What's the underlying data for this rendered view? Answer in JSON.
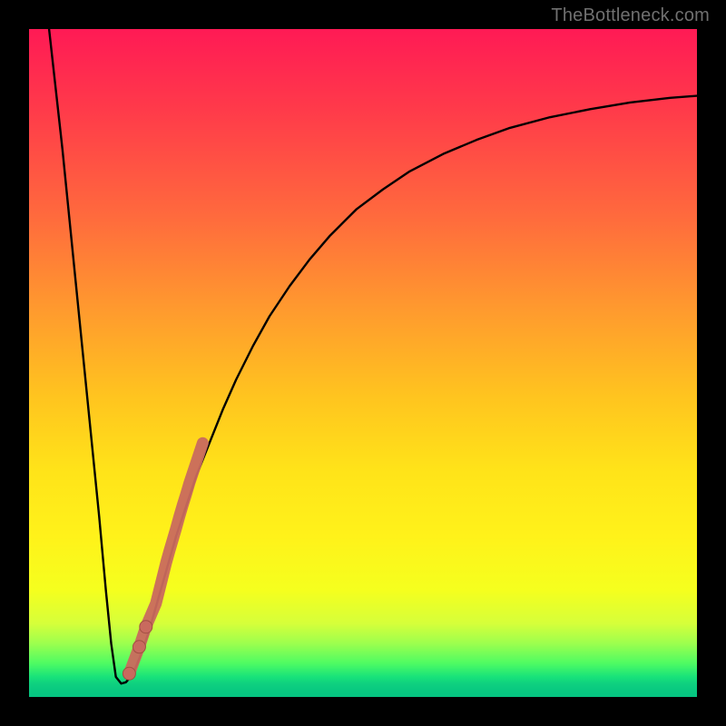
{
  "watermark": {
    "text": "TheBottleneck.com"
  },
  "colors": {
    "background_frame": "#000000",
    "curve_stroke": "#000000",
    "marker_fill": "#c96a5e",
    "marker_stroke": "#a24f43"
  },
  "chart_data": {
    "type": "line",
    "title": "",
    "xlabel": "",
    "ylabel": "",
    "xlim": [
      0,
      100
    ],
    "ylim": [
      0,
      100
    ],
    "grid": false,
    "legend_position": "none",
    "series": [
      {
        "name": "bottleneck-curve",
        "x": [
          3.0,
          5.0,
          7.0,
          9.0,
          10.5,
          11.5,
          12.3,
          13.0,
          13.8,
          14.5,
          15.2,
          16.0,
          17.0,
          18.0,
          19.0,
          20.0,
          21.0,
          22.0,
          23.5,
          25.0,
          27.0,
          29.0,
          31.0,
          33.5,
          36.0,
          39.0,
          42.0,
          45.0,
          49.0,
          53.0,
          57.0,
          62.0,
          67.0,
          72.0,
          78.0,
          84.0,
          90.0,
          96.0,
          100.0
        ],
        "y": [
          100.0,
          82.0,
          62.0,
          42.0,
          27.0,
          16.0,
          8.0,
          3.0,
          2.0,
          2.2,
          3.0,
          4.5,
          7.0,
          10.0,
          13.5,
          17.0,
          20.5,
          24.0,
          28.5,
          33.0,
          38.0,
          43.0,
          47.5,
          52.5,
          57.0,
          61.5,
          65.5,
          69.0,
          73.0,
          76.0,
          78.7,
          81.3,
          83.4,
          85.2,
          86.8,
          88.0,
          89.0,
          89.7,
          90.0
        ]
      },
      {
        "name": "highlighted-segment",
        "marker": true,
        "x": [
          15.0,
          16.5,
          17.5,
          19.0,
          19.5,
          20.0,
          20.5,
          21.0,
          21.5,
          22.0,
          22.5,
          23.0,
          23.5,
          24.0,
          24.5,
          25.0,
          25.5,
          26.0
        ],
        "y": [
          3.5,
          7.5,
          10.5,
          14.0,
          16.0,
          18.0,
          20.0,
          21.8,
          23.5,
          25.2,
          27.0,
          28.7,
          30.3,
          32.0,
          33.5,
          35.0,
          36.5,
          38.0
        ]
      }
    ]
  }
}
